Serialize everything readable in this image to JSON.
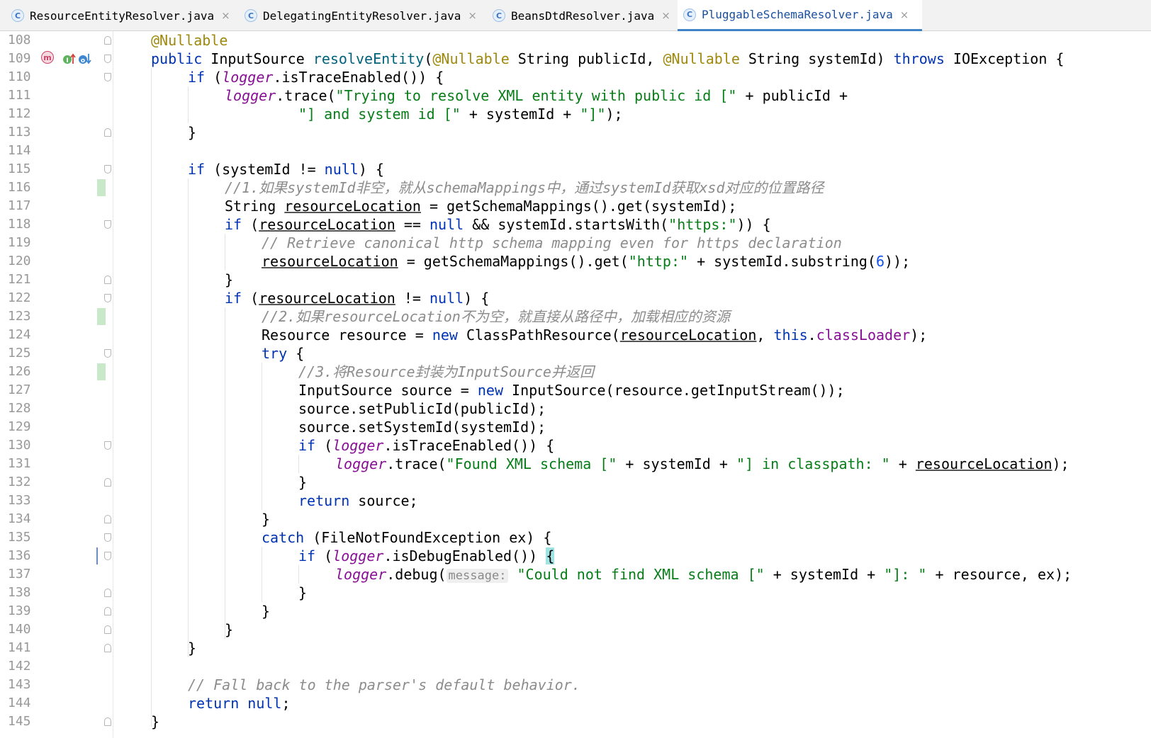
{
  "tabs": [
    {
      "label": "ResourceEntityResolver.java",
      "icon": "class-icon",
      "active": false
    },
    {
      "label": "DelegatingEntityResolver.java",
      "icon": "class-icon",
      "active": false
    },
    {
      "label": "BeansDtdResolver.java",
      "icon": "class-icon",
      "active": false
    },
    {
      "label": "PluggableSchemaResolver.java",
      "icon": "class-icon",
      "active": true
    }
  ],
  "tab_icon_letter": "C",
  "tab_close_glyph": "×",
  "gutter": {
    "line_numbers": [
      "108",
      "109",
      "110",
      "111",
      "112",
      "113",
      "114",
      "115",
      "116",
      "117",
      "118",
      "119",
      "120",
      "121",
      "122",
      "123",
      "124",
      "125",
      "126",
      "127",
      "128",
      "129",
      "130",
      "131",
      "132",
      "133",
      "134",
      "135",
      "136",
      "137",
      "138",
      "139",
      "140",
      "141",
      "142",
      "143",
      "144",
      "145"
    ],
    "line109_icons": [
      "method-marker-icon",
      "implements-up-icon",
      "implemented-down-icon"
    ],
    "changed_lines": [
      "116",
      "123",
      "126"
    ],
    "caret_line": "136"
  },
  "code_lines": {
    "l108": {
      "ann": "@Nullable"
    },
    "l109": {
      "kw1": "public",
      "t1": " InputSource ",
      "fn": "resolveEntity",
      "t2": "(",
      "ann1": "@Nullable",
      "t3": " String publicId, ",
      "ann2": "@Nullable",
      "t4": " String systemId) ",
      "kw2": "throws",
      "t5": " IOException {"
    },
    "l110": {
      "kw": "if",
      "t1": " (",
      "fld": "logger",
      "t2": ".isTraceEnabled()) {"
    },
    "l111": {
      "fld": "logger",
      "t1": ".trace(",
      "str": "\"Trying to resolve XML entity with public id [\"",
      "t2": " + publicId +"
    },
    "l112": {
      "str1": "\"] and system id [\"",
      "t1": " + systemId + ",
      "str2": "\"]\"",
      "t2": ");"
    },
    "l113": {
      "t": "}"
    },
    "l115": {
      "kw1": "if",
      "t1": " (systemId != ",
      "kw2": "null",
      "t2": ") {"
    },
    "l116": {
      "cmt": "//1.如果systemId非空，就从schemaMappings中，通过systemId获取xsd对应的位置路径"
    },
    "l117": {
      "t1": "String ",
      "var": "resourceLocation",
      "t2": " = getSchemaMappings().get(systemId);"
    },
    "l118": {
      "kw1": "if",
      "t1": " (",
      "var": "resourceLocation",
      "t2": " == ",
      "kw2": "null",
      "t3": " && systemId.startsWith(",
      "str": "\"https:\"",
      "t4": ")) {"
    },
    "l119": {
      "cmt": "// Retrieve canonical http schema mapping even for https declaration"
    },
    "l120": {
      "var": "resourceLocation",
      "t1": " = getSchemaMappings().get(",
      "str": "\"http:\"",
      "t2": " + systemId.substring(",
      "num": "6",
      "t3": "));"
    },
    "l121": {
      "t": "}"
    },
    "l122": {
      "kw1": "if",
      "t1": " (",
      "var": "resourceLocation",
      "t2": " != ",
      "kw2": "null",
      "t3": ") {"
    },
    "l123": {
      "cmt": "//2.如果resourceLocation不为空，就直接从路径中，加载相应的资源"
    },
    "l124": {
      "t1": "Resource resource = ",
      "kw1": "new",
      "t2": " ClassPathResource(",
      "var": "resourceLocation",
      "t3": ", ",
      "kw2": "this",
      "t4": ".",
      "fld": "classLoader",
      "t5": ");"
    },
    "l125": {
      "kw": "try",
      "t": " {"
    },
    "l126": {
      "cmt": "//3.将Resource封装为InputSource并返回"
    },
    "l127": {
      "t1": "InputSource source = ",
      "kw": "new",
      "t2": " InputSource(resource.getInputStream());"
    },
    "l128": {
      "t": "source.setPublicId(publicId);"
    },
    "l129": {
      "t": "source.setSystemId(systemId);"
    },
    "l130": {
      "kw": "if",
      "t1": " (",
      "fld": "logger",
      "t2": ".isTraceEnabled()) {"
    },
    "l131": {
      "fld": "logger",
      "t1": ".trace(",
      "str1": "\"Found XML schema [\"",
      "t2": " + systemId + ",
      "str2": "\"] in classpath: \"",
      "t3": " + ",
      "var": "resourceLocation",
      "t4": ");"
    },
    "l132": {
      "t": "}"
    },
    "l133": {
      "kw": "return",
      "t": " source;"
    },
    "l134": {
      "t": "}"
    },
    "l135": {
      "kw": "catch",
      "t": " (FileNotFoundException ex) {"
    },
    "l136": {
      "kw": "if",
      "t1": " (",
      "fld": "logger",
      "t2": ".isDebugEnabled()) ",
      "brace": "{"
    },
    "l137": {
      "fld": "logger",
      "t1": ".debug(",
      "hint": "message:",
      "str1": "\"Could not find XML schema [\"",
      "t2": " + systemId + ",
      "str2": "\"]: \"",
      "t3": " + resource, ex);"
    },
    "l138": {
      "t": "}"
    },
    "l139": {
      "t": "}"
    },
    "l140": {
      "t": "}"
    },
    "l141": {
      "t": "}"
    },
    "l143": {
      "cmt": "// Fall back to the parser's default behavior."
    },
    "l144": {
      "kw1": "return",
      "t1": " ",
      "kw2": "null",
      "t2": ";"
    },
    "l145": {
      "t": "}"
    }
  },
  "colors": {
    "keyword": "#0033b3",
    "annotation": "#9e880d",
    "string": "#067d17",
    "field": "#871094",
    "number": "#1750eb",
    "comment": "#8c8c8c",
    "method_decl": "#00627a",
    "active_tab_underline": "#4083c9",
    "change_marker": "#c9e7c9"
  }
}
